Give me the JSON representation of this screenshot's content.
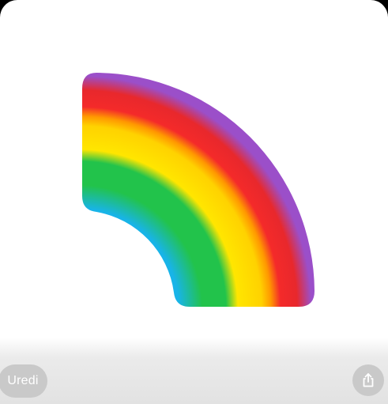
{
  "artwork": {
    "icon": "rainbow",
    "colors": [
      "#9b4fc9",
      "#f22a2a",
      "#ff8c00",
      "#ffd800",
      "#22c34b",
      "#18b4e8"
    ]
  },
  "toolbar": {
    "edit_label": "Uredi",
    "share_icon": "share-icon"
  }
}
